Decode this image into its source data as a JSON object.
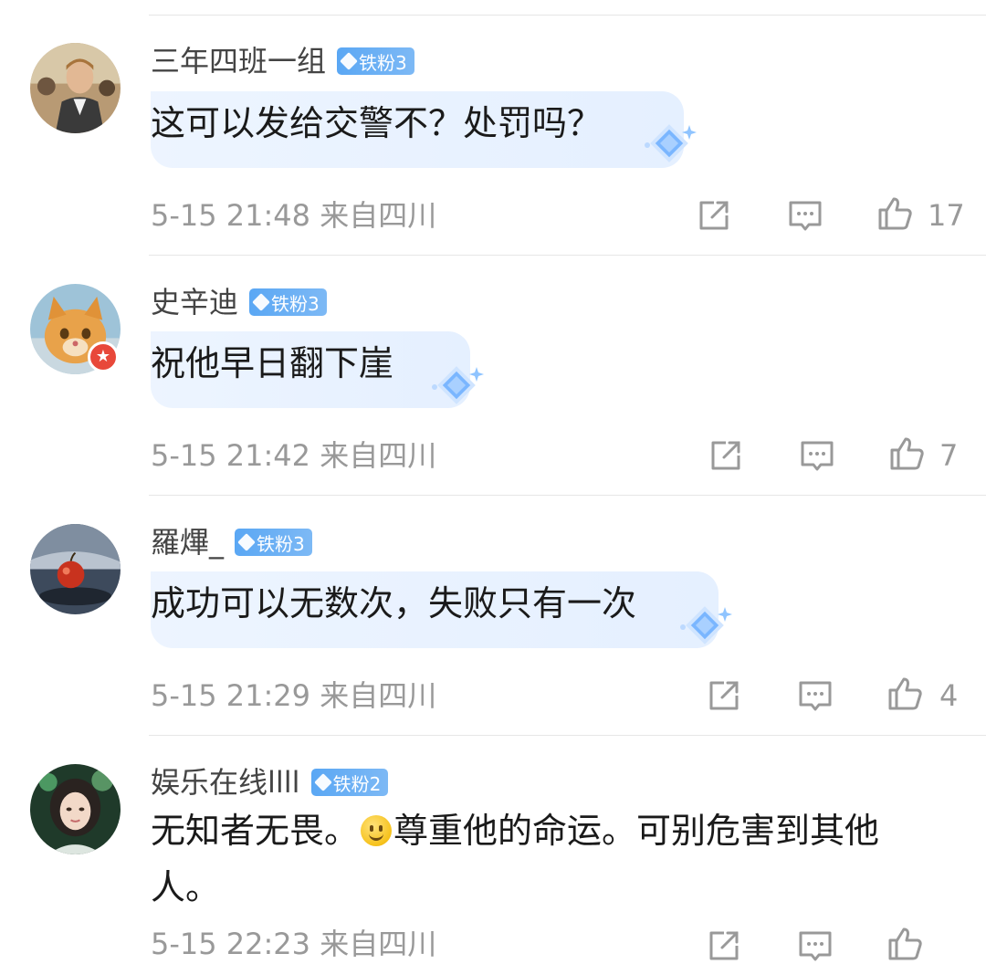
{
  "comments": [
    {
      "username": "三年四班一组",
      "badge": "铁粉3",
      "text": "这可以发给交警不？处罚吗？",
      "time": "5-15 21:48",
      "location": "来自四川",
      "likes": "17",
      "avatar_icon": "avatar-man-photo"
    },
    {
      "username": "史辛迪",
      "badge": "铁粉3",
      "text": "祝他早日翻下崖",
      "time": "5-15 21:42",
      "location": "来自四川",
      "likes": "7",
      "avatar_icon": "avatar-cat-photo"
    },
    {
      "username": "羅熚_",
      "badge": "铁粉3",
      "text": "成功可以无数次，失败只有一次",
      "time": "5-15 21:29",
      "location": "来自四川",
      "likes": "4",
      "avatar_icon": "avatar-apple-photo"
    },
    {
      "username": "娱乐在线llll",
      "badge": "铁粉2",
      "text_before_emoji": "无知者无畏。",
      "emoji": "smile-emoji",
      "text_after_emoji": "尊重他的命运。可别危害到其他人。",
      "time": "5-15 22:23",
      "location": "来自四川",
      "avatar_icon": "avatar-woman-photo"
    }
  ],
  "colors": {
    "badge": "#5aa7f4",
    "meta_text": "#999999",
    "bubble": "#eaf2ff"
  }
}
